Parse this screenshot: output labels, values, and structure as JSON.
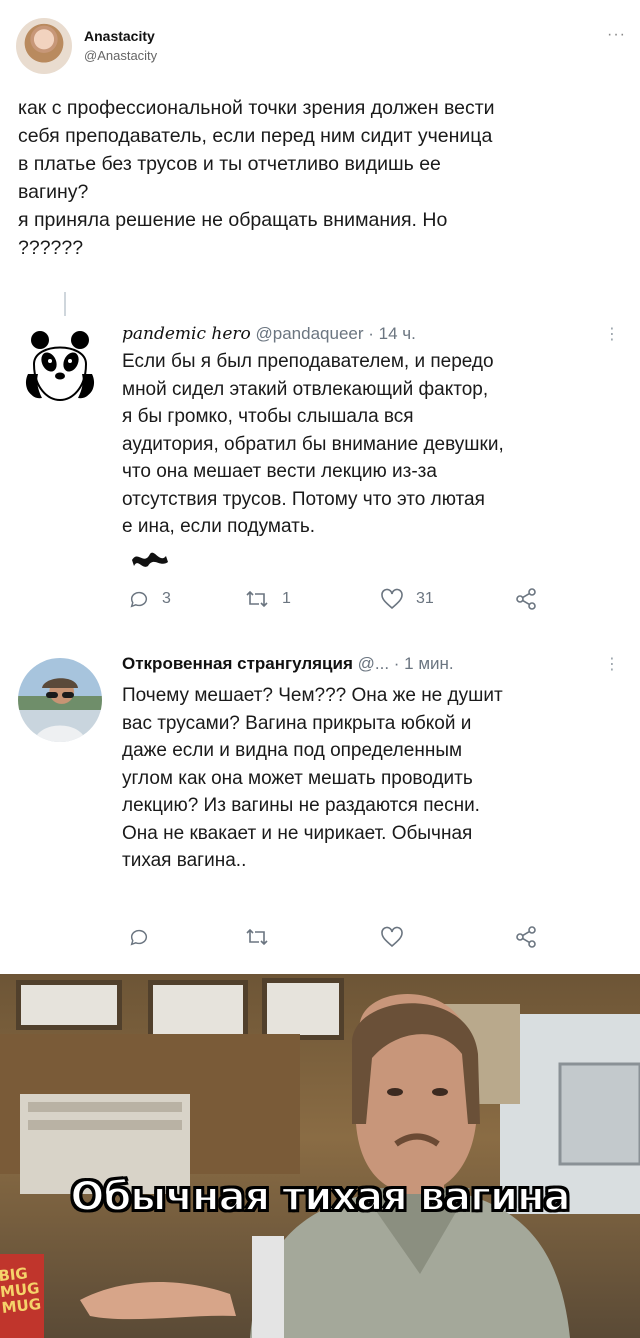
{
  "tweet": {
    "author_name": "Anastacity",
    "author_handle": "@Anastacity",
    "more": "···",
    "text": "как с профессиональной точки зрения должен вести\nсебя преподаватель, если перед ним сидит ученица\nв платье без трусов и ты отчетливо видишь ее\nвагину?\nя приняла решение не обращать внимания. Но\n??????"
  },
  "replies": [
    {
      "name": "pandemic hero",
      "handle": "@pandaqueer",
      "time": "· 14 ч.",
      "more": "⋮",
      "text": "Если бы я был преподавателем, и передо\nмной сидел этакий отвлекающий фактор,\nя бы громко, чтобы слышала вся\nаудитория, обратил бы внимание девушки,\nчто она мешает вести лекцию из-за\nотсутствия трусов. Потому что это лютая\nе     ина, если подумать.",
      "counts": {
        "reply": "3",
        "retweet": "1",
        "like": "31"
      }
    },
    {
      "name": "Откровенная странгуляция",
      "handle": "@...",
      "time": "· 1 мин.",
      "more": "⋮",
      "text": "Почему мешает? Чем??? Она же не душит\nвас трусами? Вагина прикрыта юбкой и\nдаже если и видна под определенным\nуглом как она может мешать проводить\nлекцию? Из вагины не раздаются песни.\nОна не квакает и не чирикает. Обычная\nтихая вагина..",
      "counts": {
        "reply": "",
        "retweet": "",
        "like": ""
      }
    }
  ],
  "meme": {
    "caption": "Обычная тихая вагина",
    "mug_text": "BIG\nMUG\nMUG"
  },
  "colors": {
    "text": "#1a1a1a",
    "secondary": "#6b7580",
    "thread_line": "#cfd6dc",
    "caption_fill": "#ffffff",
    "caption_stroke": "#000000"
  }
}
